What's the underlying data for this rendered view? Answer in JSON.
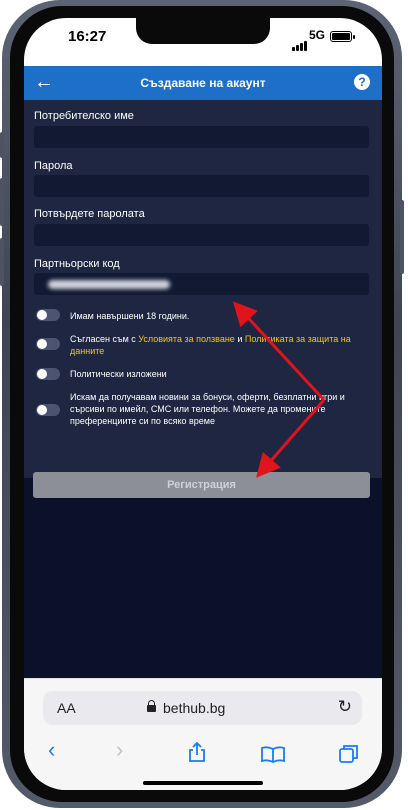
{
  "status_bar": {
    "time": "16:27",
    "network": "5G"
  },
  "app": {
    "title": "Създаване на акаунт",
    "fields": [
      {
        "label": "Потребителско име",
        "value": ""
      },
      {
        "label": "Парола",
        "value": ""
      },
      {
        "label": "Потвърдете паролата",
        "value": ""
      },
      {
        "label": "Партньорски код",
        "value": ""
      }
    ],
    "toggles": [
      {
        "text": "Имам навършени 18 години.",
        "on": false
      },
      {
        "text_before": "Съгласен съм с ",
        "link1": "Условията за ползване",
        "text_mid": " и ",
        "link2": "Политиката за защита на данните",
        "on": false
      },
      {
        "text": "Политически изложени",
        "on": false
      },
      {
        "text": "Искам да получавам новини за бонуси, оферти, безплатни игри и сърсиви по имейл, СМС или телефон. Можете да промените преференциите си по всяко време",
        "on": false
      }
    ],
    "register_button": "Регистрация"
  },
  "browser": {
    "aa_label": "AA",
    "url": "bethub.bg"
  },
  "colors": {
    "appbar": "#1d6fc8",
    "background": "#0b1129",
    "form_panel": "#1e2641",
    "link": "#f5c518",
    "annotation_arrow": "#e0141b"
  },
  "icons": [
    "back-arrow-icon",
    "help-icon",
    "lock-icon",
    "reload-icon",
    "share-icon",
    "bookmarks-icon",
    "tabs-icon"
  ]
}
